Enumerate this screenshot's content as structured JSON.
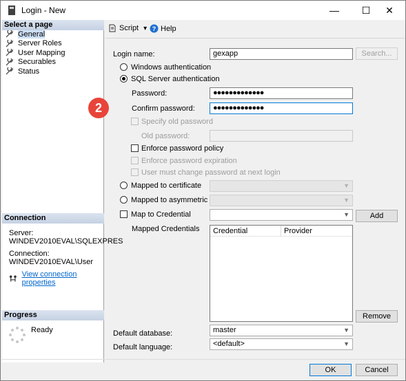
{
  "window": {
    "title": "Login - New",
    "minimize_glyph": "—",
    "maximize_glyph": "☐",
    "close_glyph": "✕"
  },
  "left_panel": {
    "select_page_header": "Select a page",
    "pages": [
      {
        "label": "General",
        "icon": "wrench-icon",
        "selected": true
      },
      {
        "label": "Server Roles",
        "icon": "wrench-icon"
      },
      {
        "label": "User Mapping",
        "icon": "wrench-icon"
      },
      {
        "label": "Securables",
        "icon": "wrench-icon"
      },
      {
        "label": "Status",
        "icon": "wrench-icon"
      }
    ],
    "connection_header": "Connection",
    "server_label": "Server:",
    "server_value": "WINDEV2010EVAL\\SQLEXPRES",
    "connection_label": "Connection:",
    "connection_value": "WINDEV2010EVAL\\User",
    "view_connection_link": "View connection properties",
    "progress_header": "Progress",
    "progress_status": "Ready"
  },
  "toolbar": {
    "script_label": "Script",
    "script_dropdown": "▾",
    "help_label": "Help"
  },
  "form": {
    "login_name_label": "Login name:",
    "login_name_value": "gexapp",
    "search_button": "Search...",
    "windows_auth": "Windows authentication",
    "sql_auth": "SQL Server authentication",
    "password_label": "Password:",
    "password_value": "●●●●●●●●●●●●●",
    "confirm_password_label": "Confirm password:",
    "confirm_password_value": "●●●●●●●●●●●●●",
    "specify_old_password": "Specify old password",
    "old_password_label": "Old password:",
    "enforce_policy": "Enforce password policy",
    "enforce_expiration": "Enforce password expiration",
    "must_change": "User must change password at next login",
    "mapped_certificate": "Mapped to certificate",
    "mapped_asym_key": "Mapped to asymmetric key",
    "map_credential": "Map to Credential",
    "add_button": "Add",
    "mapped_credentials_label": "Mapped Credentials",
    "grid_columns": [
      "Credential",
      "Provider"
    ],
    "remove_button": "Remove",
    "default_database_label": "Default database:",
    "default_database_value": "master",
    "default_language_label": "Default language:",
    "default_language_value": "<default>"
  },
  "annotation_badge": "2",
  "footer": {
    "ok": "OK",
    "cancel": "Cancel"
  },
  "colors": {
    "accent": "#0078d7",
    "badge": "#e8443a",
    "link": "#0066cc"
  }
}
